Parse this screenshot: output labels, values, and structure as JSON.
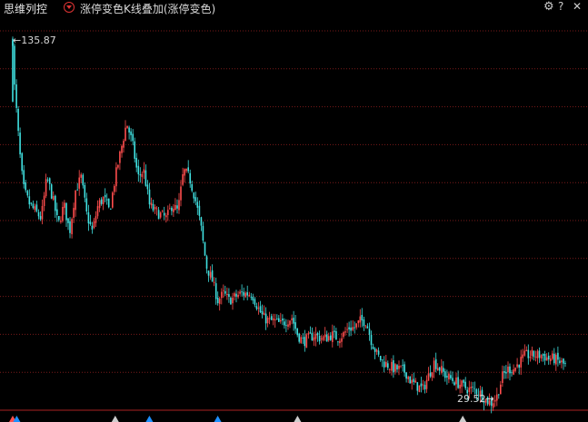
{
  "header": {
    "app_title": "思维列控",
    "indicator_title": "涨停变色K线叠加(涨停变色)",
    "settings_icon": "gear-icon",
    "help_icon": "question-icon",
    "close_icon": "close-icon"
  },
  "chart_data": {
    "type": "candlestick",
    "high_label": "135.87",
    "low_label": "29.52",
    "ylim": [
      28,
      140
    ],
    "grid": true,
    "grid_style": "dotted",
    "colors": {
      "up": "#ff4d4d",
      "down": "#40e0e0",
      "grid": "#7a1a1a",
      "background": "#000000",
      "limit_up": "#ff4d4d"
    },
    "close_path": [
      [
        0,
        136
      ],
      [
        0.2,
        125
      ],
      [
        1,
        108
      ],
      [
        1.5,
        98
      ],
      [
        2,
        92
      ],
      [
        3,
        88
      ],
      [
        4,
        86
      ],
      [
        5,
        84
      ],
      [
        6,
        96
      ],
      [
        7,
        90
      ],
      [
        8,
        82
      ],
      [
        9,
        88
      ],
      [
        10,
        80
      ],
      [
        11,
        92
      ],
      [
        12,
        96
      ],
      [
        13,
        85
      ],
      [
        14,
        80
      ],
      [
        15,
        88
      ],
      [
        16,
        90
      ],
      [
        17,
        86
      ],
      [
        18,
        96
      ],
      [
        19,
        104
      ],
      [
        20,
        112
      ],
      [
        21,
        106
      ],
      [
        22,
        96
      ],
      [
        23,
        98
      ],
      [
        24,
        88
      ],
      [
        25,
        86
      ],
      [
        26,
        85
      ],
      [
        27,
        84
      ],
      [
        28,
        88
      ],
      [
        29,
        86
      ],
      [
        30,
        98
      ],
      [
        31,
        96
      ],
      [
        32,
        90
      ],
      [
        33,
        82
      ],
      [
        34,
        70
      ],
      [
        35,
        66
      ],
      [
        36,
        60
      ],
      [
        37,
        62
      ],
      [
        38,
        60
      ],
      [
        39,
        61
      ],
      [
        40,
        62
      ],
      [
        41,
        62
      ],
      [
        42,
        62
      ],
      [
        43,
        58
      ],
      [
        44,
        55
      ],
      [
        45,
        54
      ],
      [
        46,
        54
      ],
      [
        47,
        53
      ],
      [
        48,
        54
      ],
      [
        49,
        55
      ],
      [
        50,
        50
      ],
      [
        51,
        48
      ],
      [
        52,
        49
      ],
      [
        53,
        50
      ],
      [
        54,
        49
      ],
      [
        55,
        49
      ],
      [
        56,
        50
      ],
      [
        57,
        49
      ],
      [
        58,
        50
      ],
      [
        59,
        52
      ],
      [
        60,
        52
      ],
      [
        61,
        54
      ],
      [
        62,
        54
      ],
      [
        63,
        48
      ],
      [
        64,
        44
      ],
      [
        65,
        42
      ],
      [
        66,
        41
      ],
      [
        67,
        40
      ],
      [
        68,
        40
      ],
      [
        69,
        39
      ],
      [
        70,
        36
      ],
      [
        71,
        35
      ],
      [
        72,
        34
      ],
      [
        73,
        38
      ],
      [
        74,
        42
      ],
      [
        75,
        40
      ],
      [
        76,
        38
      ],
      [
        77,
        37
      ],
      [
        78,
        36
      ],
      [
        79,
        35
      ],
      [
        80,
        34
      ],
      [
        81,
        34
      ],
      [
        82,
        33
      ],
      [
        83,
        31
      ],
      [
        84,
        30
      ],
      [
        85,
        32
      ],
      [
        86,
        38
      ],
      [
        87,
        40
      ],
      [
        88,
        40
      ],
      [
        89,
        42
      ],
      [
        90,
        44
      ],
      [
        91,
        44
      ],
      [
        92,
        44
      ],
      [
        93,
        44
      ],
      [
        94,
        43
      ],
      [
        95,
        43
      ],
      [
        96,
        42
      ],
      [
        97,
        41
      ]
    ],
    "bottom_markers": [
      {
        "t": 0,
        "color": "#ff4d4d"
      },
      {
        "t": 0.7,
        "color": "#1e90ff"
      },
      {
        "t": 18,
        "color": "#cccccc"
      },
      {
        "t": 24,
        "color": "#1e90ff"
      },
      {
        "t": 36,
        "color": "#1e90ff"
      },
      {
        "t": 50,
        "color": "#cccccc"
      },
      {
        "t": 79,
        "color": "#cccccc"
      }
    ]
  }
}
